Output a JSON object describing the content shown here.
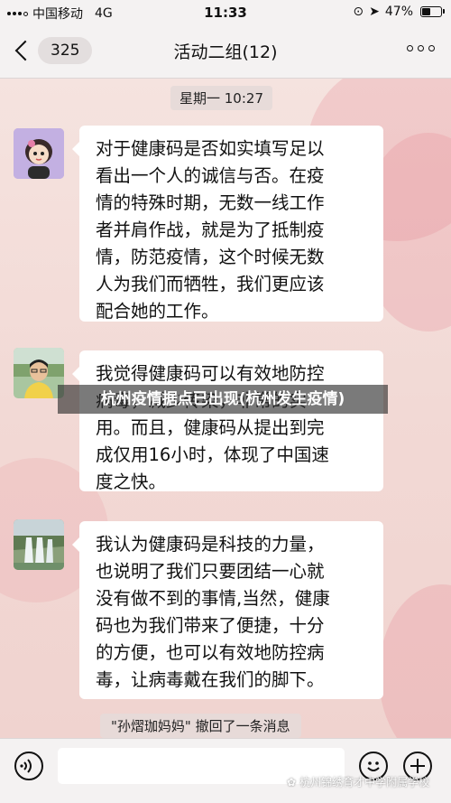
{
  "status_bar": {
    "carrier": "中国移动",
    "network": "4G",
    "time": "11:33",
    "battery": "47%",
    "battery_level": 0.47
  },
  "nav": {
    "unread_count": "325",
    "title": "活动二组(12)"
  },
  "chat": {
    "time_label": "星期一 10:27",
    "messages": [
      {
        "avatar": "cartoon-girl-avatar",
        "text": "对于健康码是否如实填写足以\n看出一个人的诚信与否。在疫\n情的特殊时期，无数一线工作\n者并肩作战，就是为了抵制疫\n情，防范疫情，这个时候无数\n人为我们而牺牲，我们更应该\n配合她的工作。"
      },
      {
        "avatar": "man-photo-avatar",
        "text": "我觉得健康码可以有效地防控\n病毒，减少传染，非常的实\n用。而且，健康码从提出到完\n成仅用16小时，体现了中国速\n度之快。"
      },
      {
        "avatar": "waterfall-avatar",
        "text": "我认为健康码是科技的力量，\n也说明了我们只要团结一心就\n没有做不到的事情,当然，健康\n码也为我们带来了便捷，十分\n的方便，也可以有效地防控病\n毒，让病毒戴在我们的脚下。"
      }
    ],
    "recall_notice": "\"孙熠珈妈妈\" 撤回了一条消息"
  },
  "watermark": "杭州疫情据点已出现(杭州发生疫情)",
  "source_watermark": "杭州锦绣育才中学附属学校",
  "colors": {
    "chat_bg": "#f3ddd8",
    "bubble": "#ffffff",
    "bar_bg": "#f4f2f2"
  }
}
